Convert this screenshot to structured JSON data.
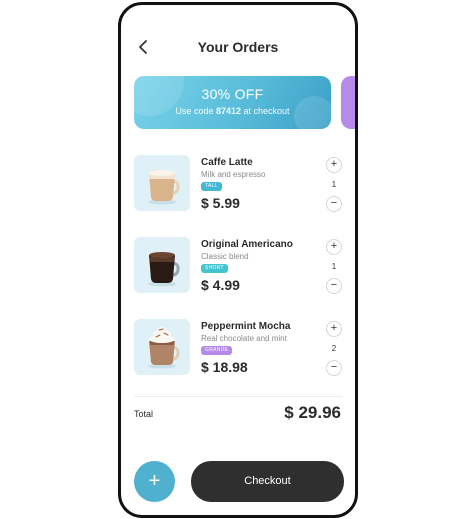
{
  "header": {
    "title": "Your Orders"
  },
  "promo": {
    "title": "30% OFF",
    "sub_prefix": "Use code",
    "code": "87412",
    "sub_suffix": "at checkout"
  },
  "items": [
    {
      "name": "Caffe Latte",
      "desc": "Milk and espresso",
      "size": "TALL",
      "size_color": "#43b8d4",
      "price": "$ 5.99",
      "qty": "1",
      "icon": "latte-cup-icon"
    },
    {
      "name": "Original Americano",
      "desc": "Classic blend",
      "size": "SHORT",
      "size_color": "#43c4cf",
      "price": "$ 4.99",
      "qty": "1",
      "icon": "americano-cup-icon"
    },
    {
      "name": "Peppermint Mocha",
      "desc": "Real chocolate and mint",
      "size": "GRANDE",
      "size_color": "#b58ae8",
      "price": "$ 18.98",
      "qty": "2",
      "icon": "mocha-cup-icon"
    }
  ],
  "stepper": {
    "plus": "+",
    "minus": "−"
  },
  "total": {
    "label": "Total",
    "value": "$ 29.96"
  },
  "actions": {
    "add": "+",
    "checkout": "Checkout"
  },
  "colors": {
    "accent": "#4fb0d0",
    "dark": "#2f2f2f",
    "promo_next": "#b58ae8"
  }
}
